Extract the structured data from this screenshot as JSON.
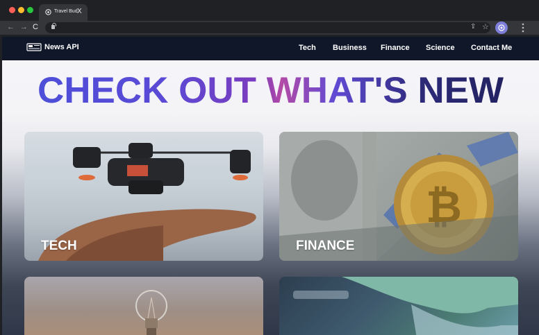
{
  "browser": {
    "tab_title": "Travel Bud",
    "tab_close": "X",
    "nav": {
      "back": "←",
      "forward": "→",
      "reload": "C"
    }
  },
  "site": {
    "brand": "News API",
    "nav_links": [
      "Tech",
      "Business",
      "Finance",
      "Science",
      "Contact Me"
    ],
    "hero_title": "CHECK OUT WHAT'S NEW",
    "cards": [
      {
        "label": "TECH",
        "image": "drone-over-hand"
      },
      {
        "label": "FINANCE",
        "image": "bitcoin-on-dollar-bills"
      },
      {
        "label": "",
        "image": "light-bulb"
      },
      {
        "label": "",
        "image": "lab-gloves"
      }
    ]
  },
  "colors": {
    "navbar": "#0f1729",
    "hero_start": "#4a4fd9",
    "hero_end": "#1e1e58",
    "profile": "#7d7fd8"
  }
}
